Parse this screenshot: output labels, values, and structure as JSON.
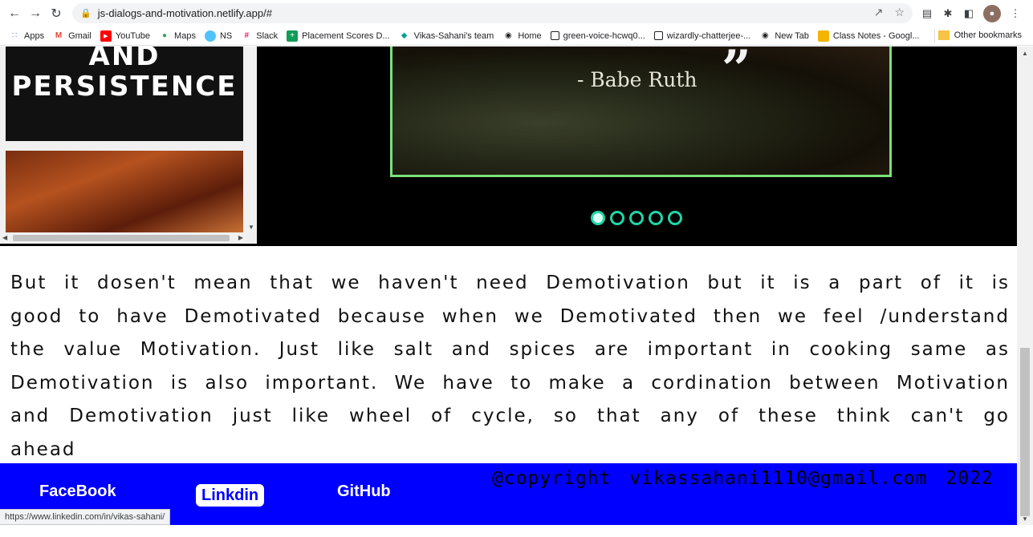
{
  "browser": {
    "url": "js-dialogs-and-motivation.netlify.app/#",
    "bookmarks": [
      "Apps",
      "Gmail",
      "YouTube",
      "Maps",
      "NS",
      "Slack",
      "Placement Scores D...",
      "Vikas-Sahani's team",
      "Home",
      "green-voice-hcwq0...",
      "wizardly-chatterjee-...",
      "New Tab",
      "Class Notes - Googl..."
    ],
    "other_bookmarks": "Other bookmarks",
    "status_url": "https://www.linkedin.com/in/vikas-sahani/"
  },
  "side_panel": {
    "card_line1": "AND",
    "card_line2": "PERSISTENCE"
  },
  "slide": {
    "author": "- Babe Ruth",
    "quote_mark": "”",
    "total_dots": 5,
    "active_dot": 1
  },
  "article": {
    "text": "But it dosen't mean that we haven't need Demotivation but it is a part of it is good to have Demotivated because when we Demotivated then we feel /understand the value Motivation. Just like salt and spices are important in cooking same as Demotivation is also important. We have to make a cordination between Motivation and Demotivation just like wheel of cycle, so that any of these think can't go ahead"
  },
  "footer": {
    "facebook": "FaceBook",
    "linkedin": "Linkdin",
    "github": "GitHub",
    "copyright": "@copyright vikassahani1110@gmail.com 2022"
  },
  "colors": {
    "footer_bg": "#0000ff",
    "slide_border": "#7be07b",
    "dot_color": "#1fd6a6"
  }
}
